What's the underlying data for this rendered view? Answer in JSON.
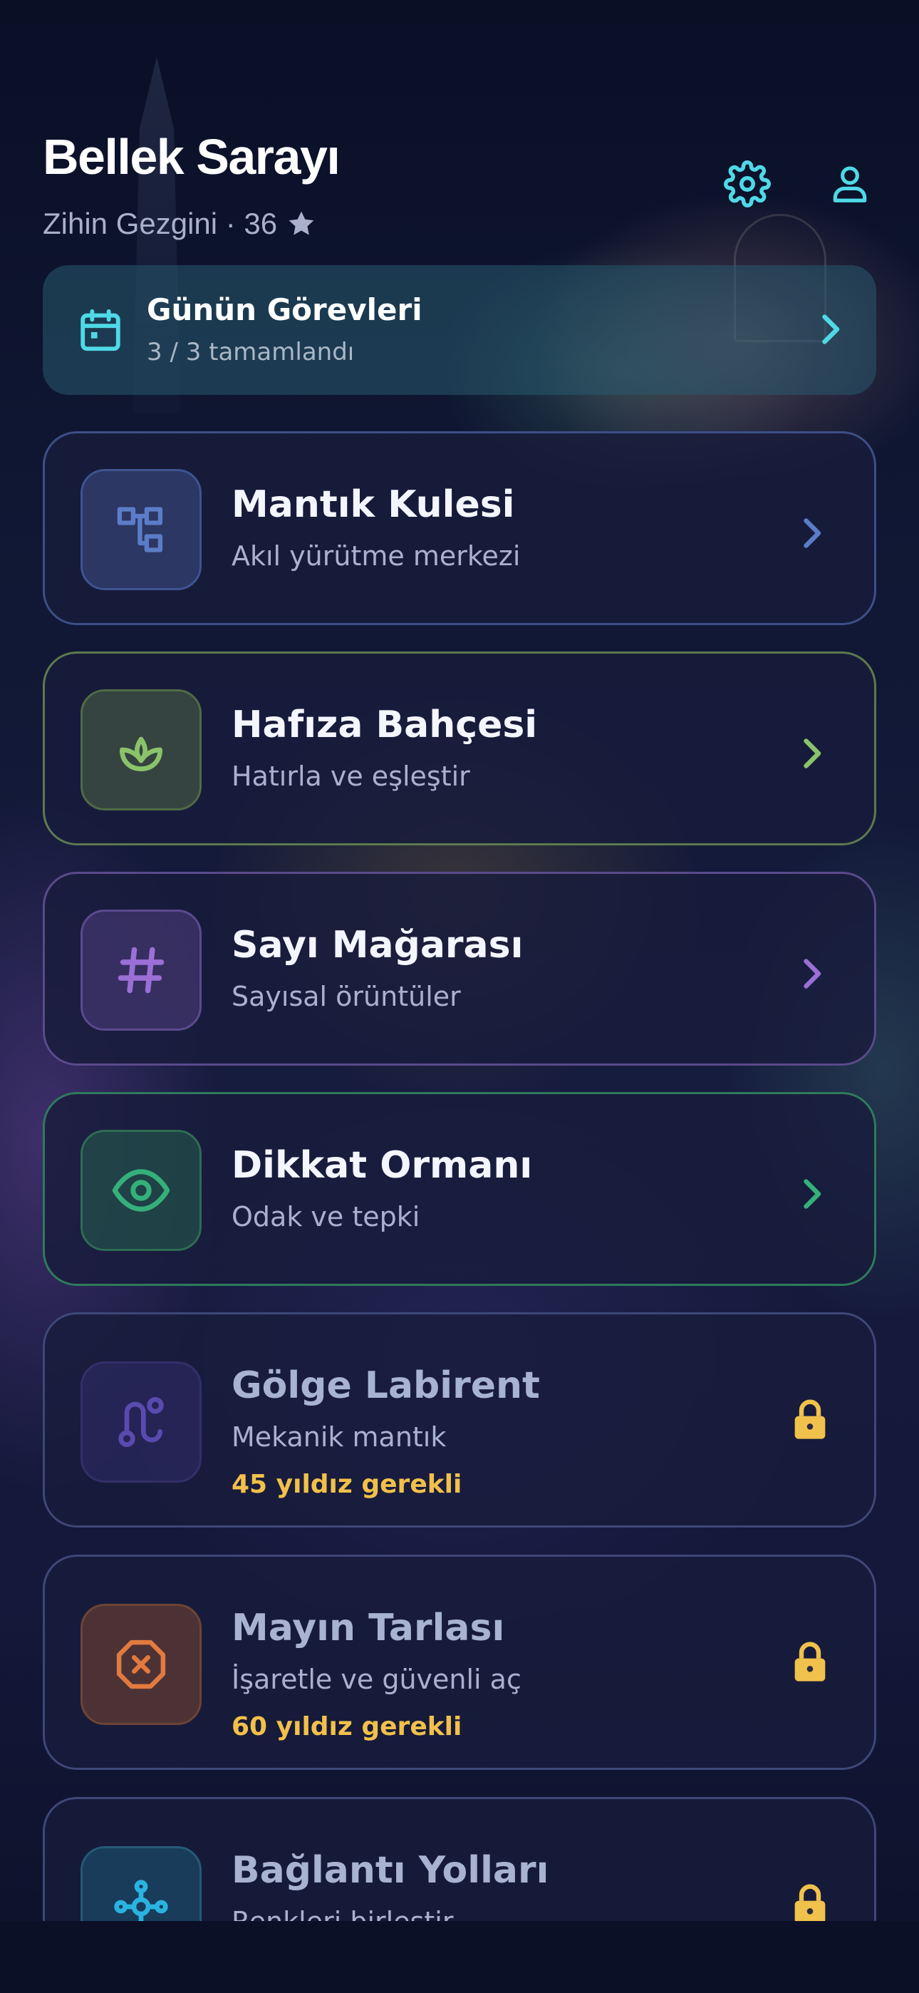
{
  "header": {
    "title": "Bellek Sarayı",
    "subtitle_user": "Zihin Gezgini · 36",
    "icons": {
      "settings": "gear-icon",
      "profile": "user-icon",
      "star": "star-icon"
    }
  },
  "daily": {
    "title": "Günün Görevleri",
    "progress": "3 / 3 tamamlandı",
    "icon": "calendar-icon"
  },
  "cards": [
    {
      "title": "Mantık Kulesi",
      "subtitle": "Akıl yürütme merkezi",
      "icon": "hierarchy-icon",
      "accent": "#5b7cc8",
      "locked": false
    },
    {
      "title": "Hafıza Bahçesi",
      "subtitle": "Hatırla ve eşleştir",
      "icon": "sprout-icon",
      "accent": "#8bc36a",
      "locked": false
    },
    {
      "title": "Sayı Mağarası",
      "subtitle": "Sayısal örüntüler",
      "icon": "hash-icon",
      "accent": "#9a6fd6",
      "locked": false
    },
    {
      "title": "Dikkat Ormanı",
      "subtitle": "Odak ve tepki",
      "icon": "eye-icon",
      "accent": "#34b07a",
      "locked": false
    },
    {
      "title": "Gölge Labirent",
      "subtitle": "Mekanik mantık",
      "requirement": "45 yıldız gerekli",
      "icon": "route-icon",
      "accent": "#5a4ab0",
      "locked": true
    },
    {
      "title": "Mayın Tarlası",
      "subtitle": "İşaretle ve güvenli aç",
      "requirement": "60 yıldız gerekli",
      "icon": "mine-icon",
      "accent": "#e27a3f",
      "locked": true
    },
    {
      "title": "Bağlantı Yolları",
      "subtitle": "Renkleri birleştir",
      "icon": "network-icon",
      "accent": "#2ab3e0",
      "locked": true
    }
  ],
  "colors": {
    "cyan": "#4fd9e6",
    "gold": "#f2c04a",
    "lock": "#f0c14b"
  }
}
